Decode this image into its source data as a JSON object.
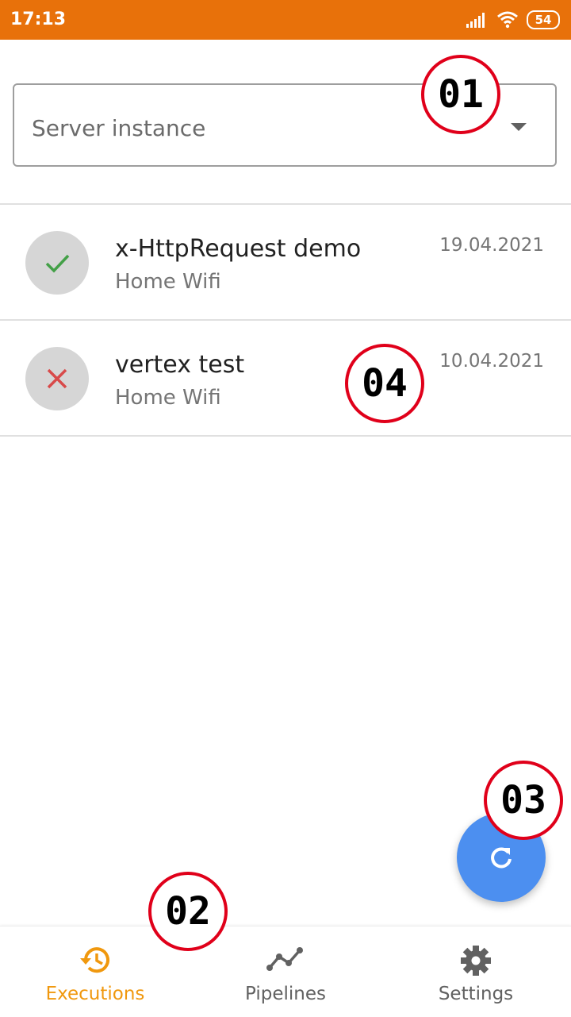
{
  "status_bar": {
    "time": "17:13",
    "battery": "54"
  },
  "server_select": {
    "placeholder": "Server instance"
  },
  "executions": [
    {
      "title": "x-HttpRequest demo",
      "subtitle": "Home Wifi",
      "date": "19.04.2021",
      "status": "success",
      "status_icon": "check-icon",
      "status_color": "#43a047"
    },
    {
      "title": "vertex test",
      "subtitle": "Home Wifi",
      "date": "10.04.2021",
      "status": "failed",
      "status_icon": "close-icon",
      "status_color": "#d84a4a"
    }
  ],
  "fab": {
    "icon": "refresh-icon",
    "color": "#4c8ff0"
  },
  "bottom_nav": {
    "items": [
      {
        "label": "Executions",
        "icon": "history-icon",
        "active": true
      },
      {
        "label": "Pipelines",
        "icon": "pipeline-icon",
        "active": false
      },
      {
        "label": "Settings",
        "icon": "gear-icon",
        "active": false
      }
    ],
    "active_color": "#f0980e"
  },
  "annotations": [
    "01",
    "02",
    "03",
    "04"
  ],
  "colors": {
    "status_bar": "#e8710a",
    "callout_ring": "#e0001a"
  }
}
